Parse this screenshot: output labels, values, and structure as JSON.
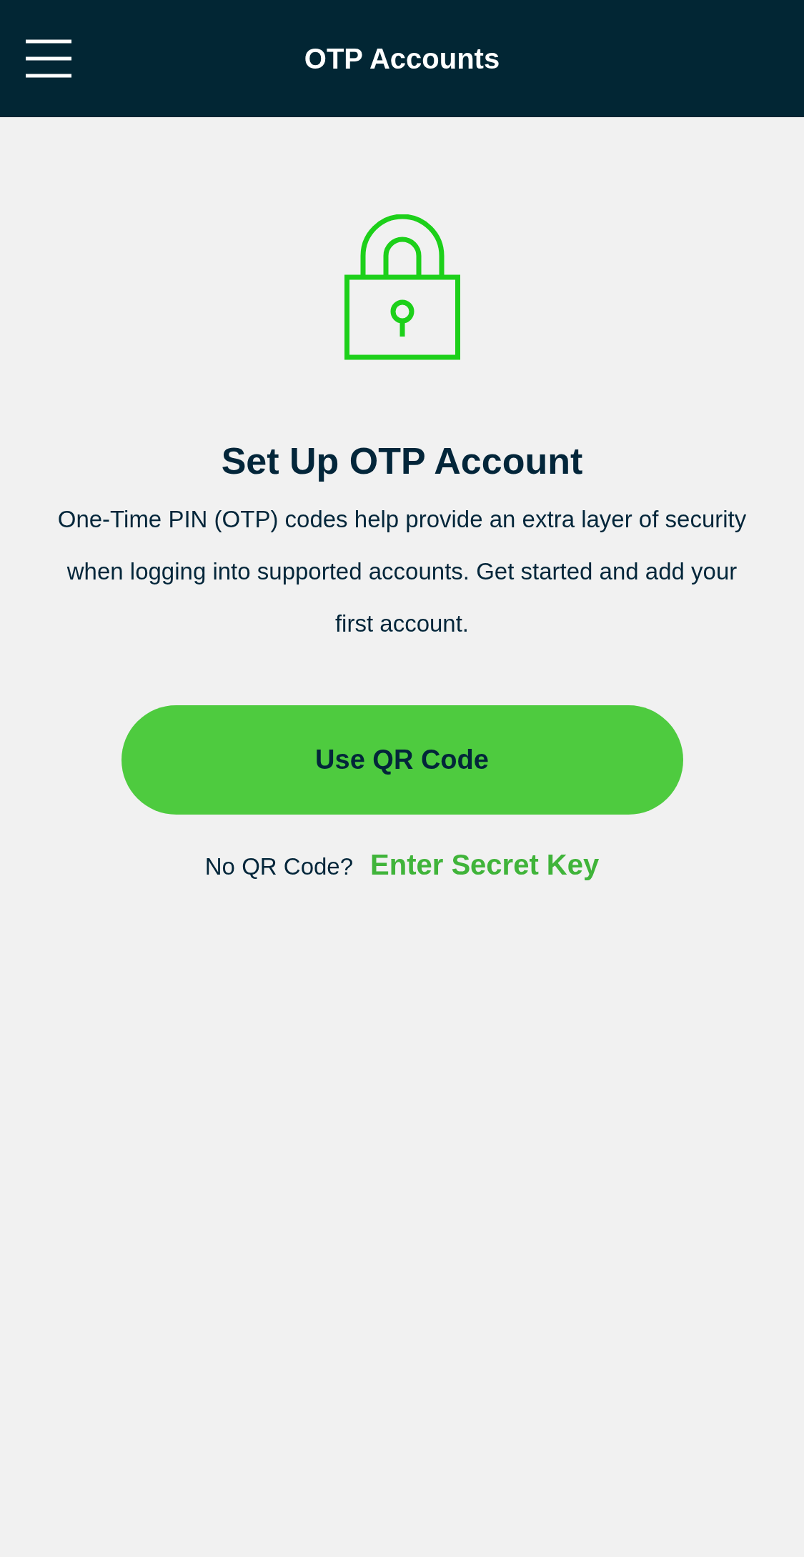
{
  "header": {
    "title": "OTP Accounts"
  },
  "empty_state": {
    "heading": "Set Up OTP Account",
    "description": "One-Time PIN (OTP) codes help provide an extra layer of security when logging into supported accounts. Get started and add your first account."
  },
  "primary_button": {
    "label": "Use QR Code"
  },
  "alternative": {
    "prompt": "No QR Code?",
    "link": "Enter Secret Key"
  }
}
